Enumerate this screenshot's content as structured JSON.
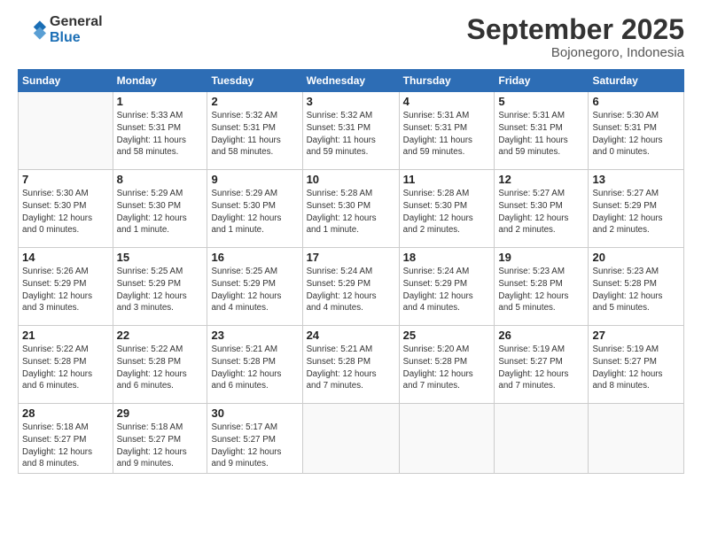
{
  "logo": {
    "line1": "General",
    "line2": "Blue"
  },
  "header": {
    "month": "September 2025",
    "location": "Bojonegoro, Indonesia"
  },
  "days_of_week": [
    "Sunday",
    "Monday",
    "Tuesday",
    "Wednesday",
    "Thursday",
    "Friday",
    "Saturday"
  ],
  "weeks": [
    [
      {
        "num": "",
        "info": ""
      },
      {
        "num": "1",
        "info": "Sunrise: 5:33 AM\nSunset: 5:31 PM\nDaylight: 11 hours\nand 58 minutes."
      },
      {
        "num": "2",
        "info": "Sunrise: 5:32 AM\nSunset: 5:31 PM\nDaylight: 11 hours\nand 58 minutes."
      },
      {
        "num": "3",
        "info": "Sunrise: 5:32 AM\nSunset: 5:31 PM\nDaylight: 11 hours\nand 59 minutes."
      },
      {
        "num": "4",
        "info": "Sunrise: 5:31 AM\nSunset: 5:31 PM\nDaylight: 11 hours\nand 59 minutes."
      },
      {
        "num": "5",
        "info": "Sunrise: 5:31 AM\nSunset: 5:31 PM\nDaylight: 11 hours\nand 59 minutes."
      },
      {
        "num": "6",
        "info": "Sunrise: 5:30 AM\nSunset: 5:31 PM\nDaylight: 12 hours\nand 0 minutes."
      }
    ],
    [
      {
        "num": "7",
        "info": "Sunrise: 5:30 AM\nSunset: 5:30 PM\nDaylight: 12 hours\nand 0 minutes."
      },
      {
        "num": "8",
        "info": "Sunrise: 5:29 AM\nSunset: 5:30 PM\nDaylight: 12 hours\nand 1 minute."
      },
      {
        "num": "9",
        "info": "Sunrise: 5:29 AM\nSunset: 5:30 PM\nDaylight: 12 hours\nand 1 minute."
      },
      {
        "num": "10",
        "info": "Sunrise: 5:28 AM\nSunset: 5:30 PM\nDaylight: 12 hours\nand 1 minute."
      },
      {
        "num": "11",
        "info": "Sunrise: 5:28 AM\nSunset: 5:30 PM\nDaylight: 12 hours\nand 2 minutes."
      },
      {
        "num": "12",
        "info": "Sunrise: 5:27 AM\nSunset: 5:30 PM\nDaylight: 12 hours\nand 2 minutes."
      },
      {
        "num": "13",
        "info": "Sunrise: 5:27 AM\nSunset: 5:29 PM\nDaylight: 12 hours\nand 2 minutes."
      }
    ],
    [
      {
        "num": "14",
        "info": "Sunrise: 5:26 AM\nSunset: 5:29 PM\nDaylight: 12 hours\nand 3 minutes."
      },
      {
        "num": "15",
        "info": "Sunrise: 5:25 AM\nSunset: 5:29 PM\nDaylight: 12 hours\nand 3 minutes."
      },
      {
        "num": "16",
        "info": "Sunrise: 5:25 AM\nSunset: 5:29 PM\nDaylight: 12 hours\nand 4 minutes."
      },
      {
        "num": "17",
        "info": "Sunrise: 5:24 AM\nSunset: 5:29 PM\nDaylight: 12 hours\nand 4 minutes."
      },
      {
        "num": "18",
        "info": "Sunrise: 5:24 AM\nSunset: 5:29 PM\nDaylight: 12 hours\nand 4 minutes."
      },
      {
        "num": "19",
        "info": "Sunrise: 5:23 AM\nSunset: 5:28 PM\nDaylight: 12 hours\nand 5 minutes."
      },
      {
        "num": "20",
        "info": "Sunrise: 5:23 AM\nSunset: 5:28 PM\nDaylight: 12 hours\nand 5 minutes."
      }
    ],
    [
      {
        "num": "21",
        "info": "Sunrise: 5:22 AM\nSunset: 5:28 PM\nDaylight: 12 hours\nand 6 minutes."
      },
      {
        "num": "22",
        "info": "Sunrise: 5:22 AM\nSunset: 5:28 PM\nDaylight: 12 hours\nand 6 minutes."
      },
      {
        "num": "23",
        "info": "Sunrise: 5:21 AM\nSunset: 5:28 PM\nDaylight: 12 hours\nand 6 minutes."
      },
      {
        "num": "24",
        "info": "Sunrise: 5:21 AM\nSunset: 5:28 PM\nDaylight: 12 hours\nand 7 minutes."
      },
      {
        "num": "25",
        "info": "Sunrise: 5:20 AM\nSunset: 5:28 PM\nDaylight: 12 hours\nand 7 minutes."
      },
      {
        "num": "26",
        "info": "Sunrise: 5:19 AM\nSunset: 5:27 PM\nDaylight: 12 hours\nand 7 minutes."
      },
      {
        "num": "27",
        "info": "Sunrise: 5:19 AM\nSunset: 5:27 PM\nDaylight: 12 hours\nand 8 minutes."
      }
    ],
    [
      {
        "num": "28",
        "info": "Sunrise: 5:18 AM\nSunset: 5:27 PM\nDaylight: 12 hours\nand 8 minutes."
      },
      {
        "num": "29",
        "info": "Sunrise: 5:18 AM\nSunset: 5:27 PM\nDaylight: 12 hours\nand 9 minutes."
      },
      {
        "num": "30",
        "info": "Sunrise: 5:17 AM\nSunset: 5:27 PM\nDaylight: 12 hours\nand 9 minutes."
      },
      {
        "num": "",
        "info": ""
      },
      {
        "num": "",
        "info": ""
      },
      {
        "num": "",
        "info": ""
      },
      {
        "num": "",
        "info": ""
      }
    ]
  ]
}
